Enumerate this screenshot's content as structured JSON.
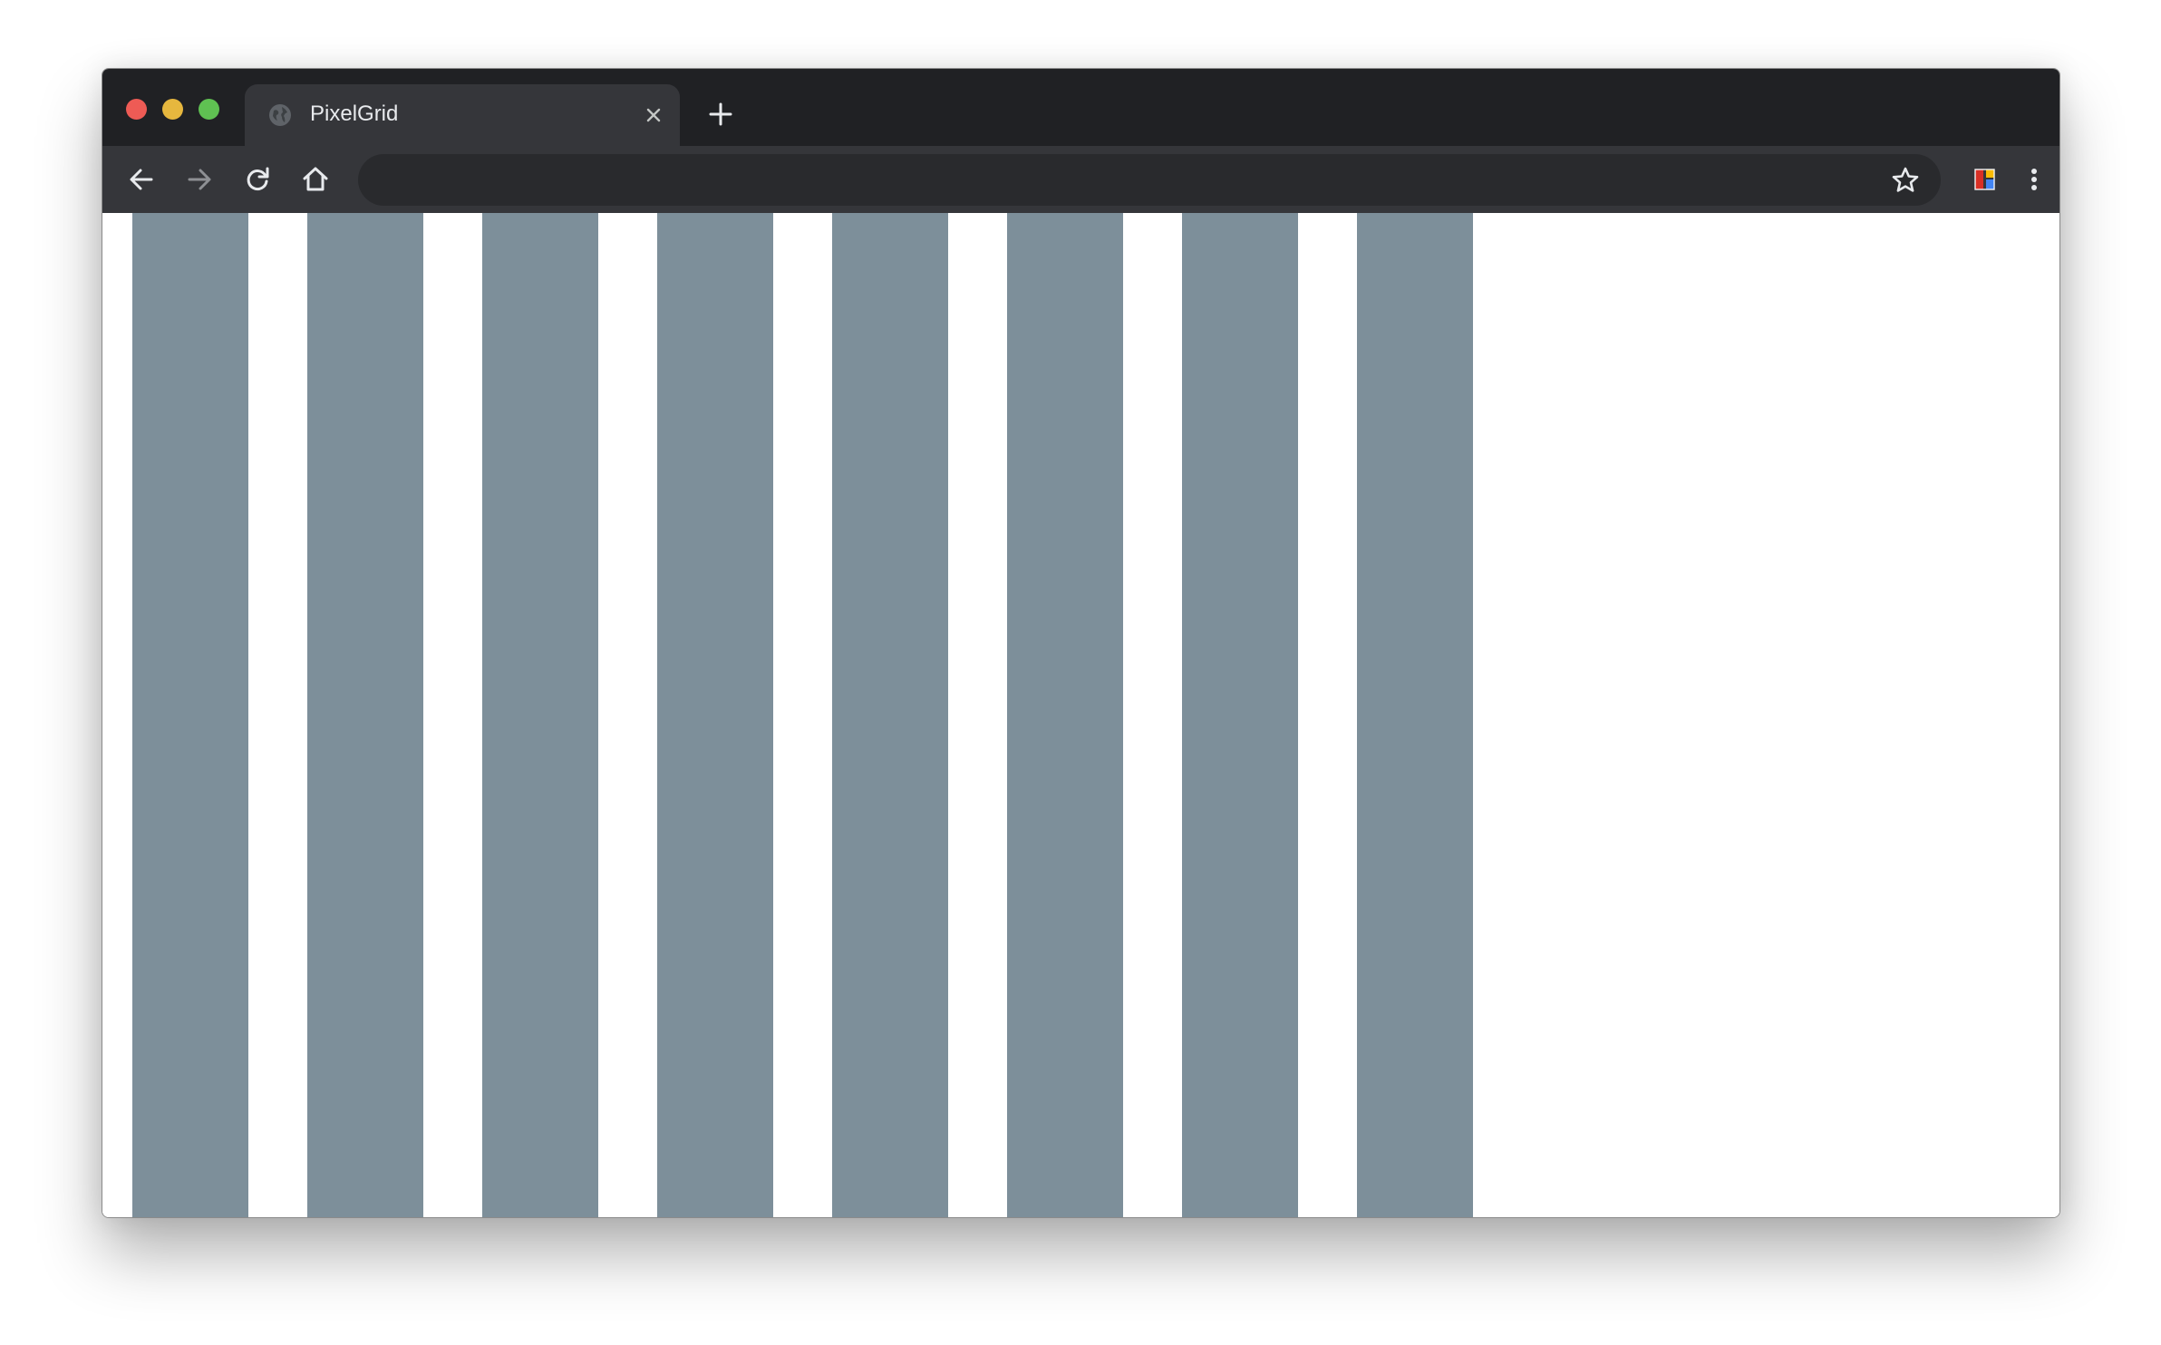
{
  "browser": {
    "window_controls": [
      {
        "name": "close",
        "color": "#ee5b55"
      },
      {
        "name": "minimize",
        "color": "#e6b73e"
      },
      {
        "name": "zoom",
        "color": "#5fc152"
      }
    ],
    "tab": {
      "title": "PixelGrid",
      "favicon": "globe-icon",
      "close_icon": "close-icon"
    },
    "new_tab_icon": "plus-icon",
    "toolbar": {
      "back_icon": "arrow-left-icon",
      "forward_icon": "arrow-right-icon",
      "reload_icon": "reload-icon",
      "home_icon": "home-icon",
      "address_value": "",
      "bookmark_icon": "star-icon",
      "extension_icon": "extension-icon",
      "menu_icon": "kebab-menu-icon"
    }
  },
  "page": {
    "background_color": "#ffffff",
    "grid_column_count": 8,
    "grid_column_color": "#7d8f9a"
  }
}
